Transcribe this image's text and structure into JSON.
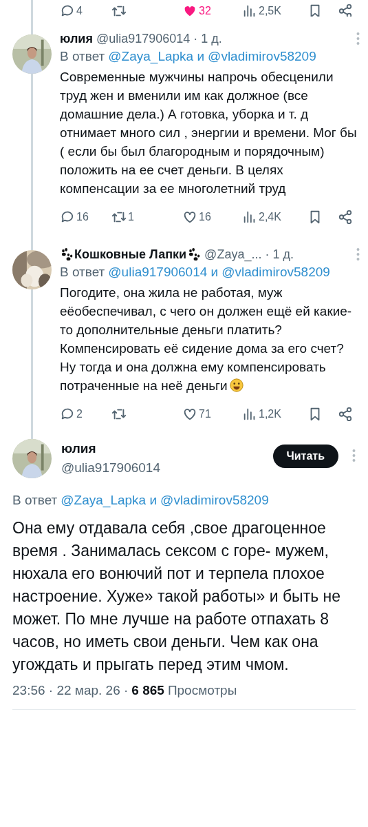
{
  "top_actions": {
    "reply": "4",
    "like": "32",
    "liked": true,
    "views": "2,5K"
  },
  "replies": [
    {
      "name": "юлия",
      "paws": false,
      "handle": "@ulia917906014",
      "time": "· 1 д.",
      "reply_prefix": "В ответ",
      "mentions": [
        "@Zaya_Lapka",
        "@vladimirov58209"
      ],
      "joiner": "и",
      "text": "Современные мужчины напрочь обесценили труд жен и вменили им как должное (все домашние дела.) А готовка, уборка и т. д отнимает много сил , энергии и времени. Мог  бы ( если бы был благородным и порядочным)  положить на ее счет деньги.  В целях компенсации за ее многолетний труд",
      "emoji": false,
      "actions": {
        "reply": "16",
        "repost": "1",
        "like": "16",
        "liked": false,
        "views": "2,4K"
      }
    },
    {
      "name": "Кошковные Лапки",
      "paws": true,
      "handle": "@Zaya_...",
      "time": "· 1 д.",
      "reply_prefix": "В ответ",
      "mentions": [
        "@ulia917906014",
        "@vladimirov58209"
      ],
      "joiner": "и",
      "text": "Погодите, она жила не работая, муж еёобеспечивал, с чего он должен ещё ей какие-то дополнительные деньги платить? Компенсировать её сидение дома за его счет? Ну тогда и она должна ему компенсировать потраченные на неё деньги",
      "emoji": true,
      "actions": {
        "reply": "2",
        "like": "71",
        "liked": false,
        "views": "1,2K"
      }
    }
  ],
  "main": {
    "name": "юлия",
    "handle": "@ulia917906014",
    "follow_button": "Читать",
    "reply_prefix": "В ответ",
    "mentions": [
      "@Zaya_Lapka",
      "@vladimirov58209"
    ],
    "joiner": "и",
    "text": "Она ему отдавала себя ,свое драгоценное время . Занималась сексом с горе- мужем, нюхала его вонючий пот и терпела плохое настроение. Хуже» такой работы» и быть не может. По мне лучше на работе отпахать 8 часов, но иметь свои деньги. Чем как она угождать и прыгать перед этим чмом.",
    "time": "23:56 · 22 мар. 26 ·",
    "views_count": "6 865",
    "views_label": "Просмотры"
  }
}
